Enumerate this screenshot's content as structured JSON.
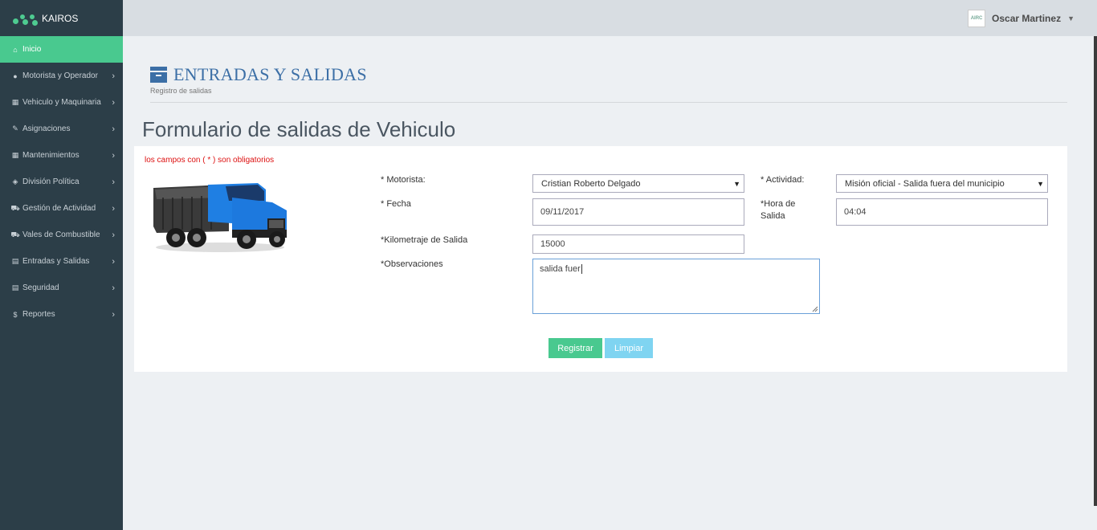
{
  "app": {
    "brand": "KAIROS"
  },
  "user": {
    "name": "Oscar Martinez",
    "avatar_text": "AIRC"
  },
  "sidebar": {
    "items": [
      {
        "label": "Inicio",
        "icon": "home-icon",
        "glyph": "⌂",
        "active": true
      },
      {
        "label": "Motorista y Operador",
        "icon": "user-icon",
        "glyph": "●"
      },
      {
        "label": "Vehiculo y Maquinaria",
        "icon": "grid-icon",
        "glyph": "▦"
      },
      {
        "label": "Asignaciones",
        "icon": "edit-icon",
        "glyph": "✎"
      },
      {
        "label": "Mantenimientos",
        "icon": "grid-icon",
        "glyph": "▦"
      },
      {
        "label": "División Política",
        "icon": "shield-icon",
        "glyph": "◈"
      },
      {
        "label": "Gestión de Actividad",
        "icon": "cart-icon",
        "glyph": "⛟"
      },
      {
        "label": "Vales de Combustible",
        "icon": "truck-icon",
        "glyph": "⛟"
      },
      {
        "label": "Entradas y Salidas",
        "icon": "file-icon",
        "glyph": "▤"
      },
      {
        "label": "Seguridad",
        "icon": "file-icon",
        "glyph": "▤"
      },
      {
        "label": "Reportes",
        "icon": "dollar-icon",
        "glyph": "$"
      }
    ]
  },
  "header": {
    "title": "ENTRADAS Y SALIDAS",
    "subtitle": "Registro de salidas"
  },
  "form": {
    "title": "Formulario de salidas de Vehiculo",
    "required_note": "los campos con ( * ) son obligatorios",
    "motorista_label": "* Motorista:",
    "motorista_value": "Cristian Roberto Delgado",
    "actividad_label": "* Actividad:",
    "actividad_value": "Misión oficial - Salida fuera del municipio",
    "fecha_label": "* Fecha",
    "fecha_value": "09/11/2017",
    "hora_label_1": "*Hora de",
    "hora_label_2": "Salida",
    "hora_value": "04:04",
    "km_label": "*Kilometraje de Salida",
    "km_value": "15000",
    "obs_label": "*Observaciones",
    "obs_value": "salida fuer",
    "register_label": "Registrar",
    "clear_label": "Limpiar"
  }
}
